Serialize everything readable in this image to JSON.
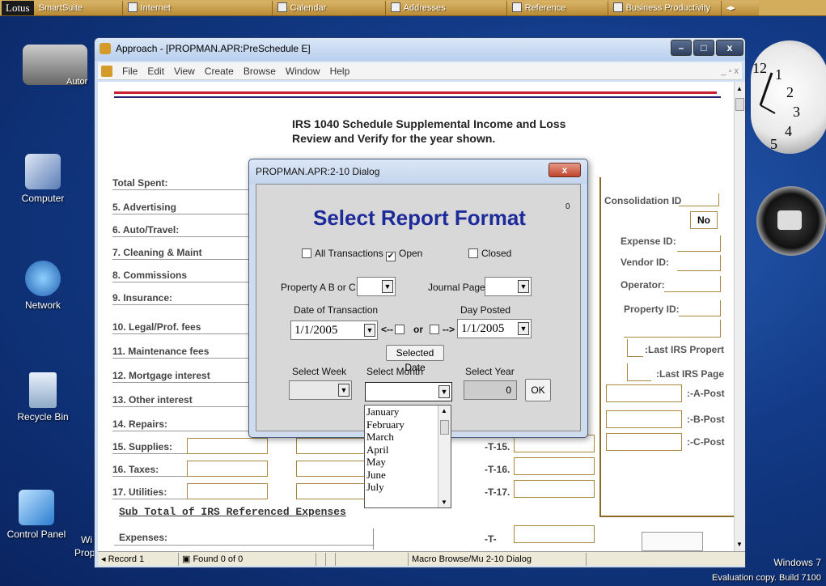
{
  "suitebar": {
    "logo": "Lotus",
    "items": [
      "SmartSuite",
      "Internet",
      "Calendar",
      "Addresses",
      "Reference",
      "Business Productivity"
    ]
  },
  "desktop": {
    "icons": [
      "Computer",
      "Network",
      "Recycle Bin",
      "Control Panel"
    ],
    "partial_top_label": "Autor",
    "partial_bottom_labels": [
      "Wi",
      "Prop"
    ]
  },
  "window": {
    "title": "Approach - [PROPMAN.APR:PreSchedule E]",
    "menu": [
      "File",
      "Edit",
      "View",
      "Create",
      "Browse",
      "Window",
      "Help"
    ],
    "status": [
      "Record 1",
      "Found 0 of 0",
      "Macro Browse/Mu 2-10 Dialog"
    ]
  },
  "form": {
    "title_line1": "IRS 1040 Schedule Supplemental Income and Loss",
    "title_line2": "Review and Verify  for the year shown.",
    "left_labels": [
      "Total Spent:",
      "5. Advertising",
      "6. Auto/Travel:",
      "7. Cleaning & Maint",
      "8. Commissions",
      "9. Insurance:",
      "10. Legal/Prof. fees",
      "11. Maintenance fees",
      "12. Mortgage interest",
      "13. Other interest",
      "14. Repairs:",
      "15. Supplies:",
      "16. Taxes:",
      "17. Utilities:"
    ],
    "t_labels": [
      "-T-15.",
      "-T-16.",
      "-T-17.",
      "-T-"
    ],
    "subtotal": "Sub Total of IRS Referenced Expenses",
    "expenses": "Expenses:",
    "right": {
      "consolidation": "Consolidation ID",
      "consolidation_value": "No",
      "expense": "Expense ID:",
      "vendor": "Vendor ID:",
      "operator": "Operator:",
      "property": "Property ID:",
      "last_property": ":Last IRS Propert",
      "last_page": ":Last IRS Page",
      "a_post": ":-A-Post",
      "b_post": ":-B-Post",
      "c_post": ":-C-Post"
    }
  },
  "dialog": {
    "title": "PROPMAN.APR:2-10 Dialog",
    "close": "x",
    "corner_value": "0",
    "heading": "Select Report Format",
    "all_transactions": "All Transactions",
    "open": "Open",
    "open_checked": true,
    "closed": "Closed",
    "property_label": "Property A B or C:",
    "journal_label": "Journal Page:",
    "date_label": "Date of Transaction",
    "day_posted_label": "Day Posted",
    "date_value": "1/1/2005",
    "day_posted_value": "1/1/2005",
    "left_arrow": "<--",
    "or": "or",
    "right_arrow": "-->",
    "selected_date_btn": "Selected Date",
    "week_label": "Select Week",
    "month_label": "Select Month",
    "year_label": "Select Year",
    "year_value": "0",
    "ok": "OK",
    "months": [
      "January",
      "February",
      "March",
      "April",
      "May",
      "June",
      "July"
    ]
  },
  "watermark": {
    "line1": "Windows 7",
    "line2": "Evaluation copy. Build 7100"
  }
}
